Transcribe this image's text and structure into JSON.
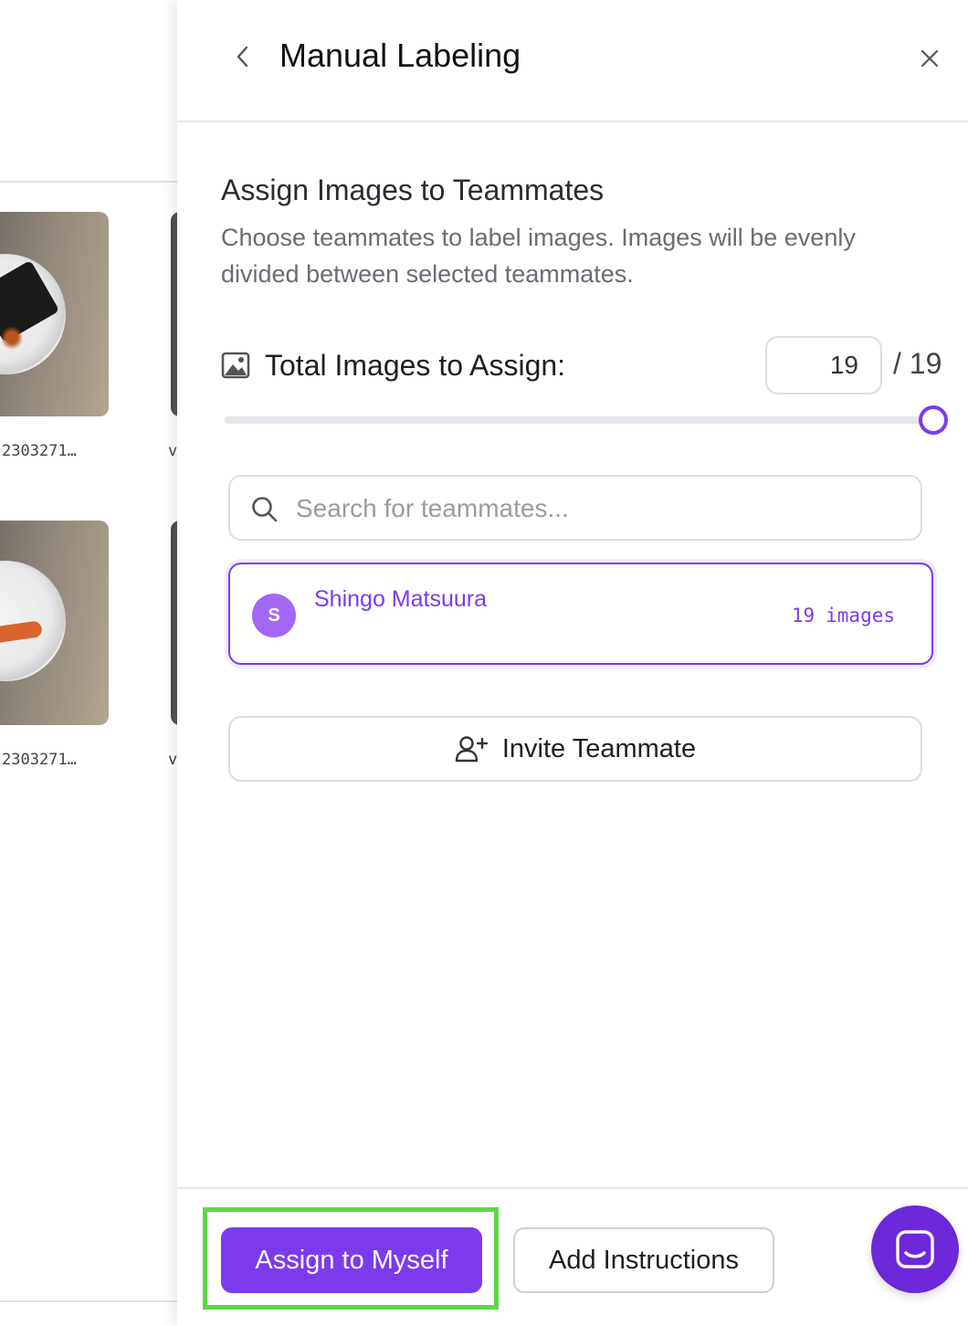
{
  "gallery": {
    "items": [
      {
        "label": "2303271…"
      },
      {
        "label": "v"
      },
      {
        "label": "2303271…"
      },
      {
        "label": "v"
      }
    ]
  },
  "panel": {
    "title": "Manual Labeling",
    "back_icon": "chevron-left-icon",
    "close_icon": "close-icon"
  },
  "assign": {
    "heading": "Assign Images to Teammates",
    "description": "Choose teammates to label images. Images will be evenly divided between selected teammates.",
    "total_label": "Total Images to Assign:",
    "total_value": "19",
    "total_max": "/ 19",
    "slider_fraction": 1.0
  },
  "search": {
    "placeholder": "Search for teammates..."
  },
  "members": [
    {
      "initial": "S",
      "name": "Shingo Matsuura",
      "count": "19",
      "count_unit": "images"
    }
  ],
  "invite": {
    "label": "Invite Teammate"
  },
  "footer": {
    "assign_label": "Assign to Myself",
    "instructions_label": "Add Instructions"
  },
  "colors": {
    "accent": "#7c3aed",
    "highlight": "#5fd646"
  }
}
